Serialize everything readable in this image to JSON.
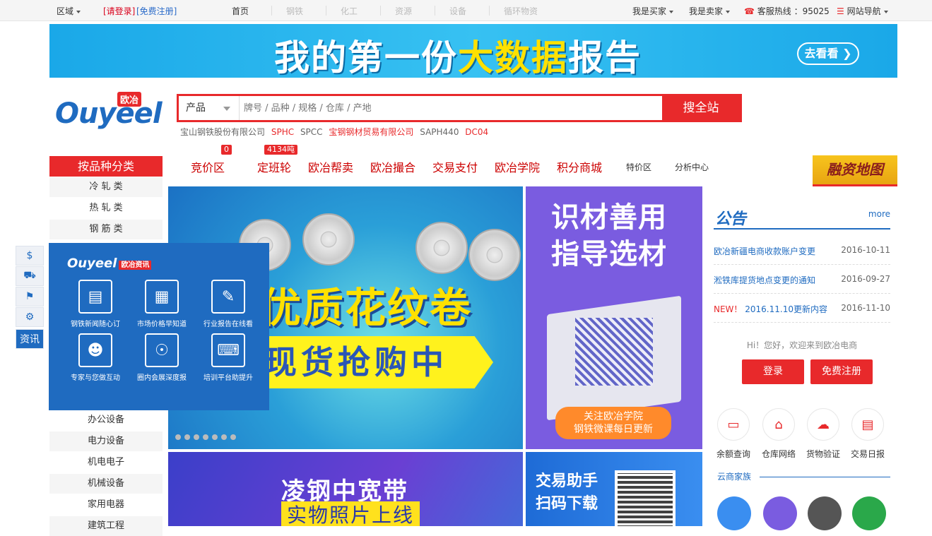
{
  "topbar": {
    "region": "区域",
    "login": "[请登录]",
    "register": "[免费注册]",
    "nav": [
      "首页",
      "钢铁",
      "化工",
      "资源",
      "设备",
      "循环物资"
    ],
    "buyer": "我是买家",
    "seller": "我是卖家",
    "hotline": "客服热线 ：95025",
    "sitenav": "网站导航"
  },
  "banner": {
    "text_before": "我的第一份",
    "text_highlight": "大数据",
    "text_after": "报告",
    "button": "去看看"
  },
  "logo": {
    "word": "Ouyeel",
    "tag": "欧冶"
  },
  "search": {
    "category": "产品",
    "placeholder": "牌号 / 品种 / 规格 / 仓库 / 产地",
    "button": "搜全站",
    "hotwords": [
      "宝山钢铁股份有限公司",
      "SPHC",
      "SPCC",
      "宝钢钢材贸易有限公司",
      "SAPH440",
      "DC04"
    ]
  },
  "category": {
    "title": "按品种分类",
    "items": [
      "冷 轧 类",
      "热 轧 类",
      "钢 筋 类"
    ],
    "items_lower": [
      "办公设备",
      "电力设备",
      "机电电子",
      "机械设备",
      "家用电器",
      "建筑工程"
    ]
  },
  "mainnav": {
    "items": [
      "竞价区",
      "定班轮",
      "欧冶帮卖",
      "欧冶撮合",
      "交易支付",
      "欧冶学院",
      "积分商城"
    ],
    "small": [
      "特价区",
      "分析中心"
    ],
    "badge_bidding": "0",
    "badge_liner": "4134吨",
    "finance_map": "融资地图"
  },
  "hero": {
    "line1": "优质花纹卷",
    "line2": "现货抢购中"
  },
  "promo": {
    "line1": "识材善用",
    "line2": "指导选材",
    "cta1": "关注欧冶学院",
    "cta2": "钢铁微课每日更新"
  },
  "banner2": {
    "line1": "凌钢中宽带",
    "line2": "实物照片上线"
  },
  "banner3": {
    "line1": "交易助手",
    "line2": "扫码下载"
  },
  "notice": {
    "title": "公告",
    "more": "more",
    "items": [
      {
        "prefix": "",
        "text": "欧冶新疆电商收款账户变更",
        "date": "2016-10-11"
      },
      {
        "prefix": "",
        "text": "淞铁库提货地点变更的通知",
        "date": "2016-09-27"
      },
      {
        "prefix": "NEW！",
        "text": "2016.11.10更新内容",
        "date": "2016-11-10"
      }
    ]
  },
  "welcome": "Hi！您好，欢迎来到欧冶电商",
  "auth": {
    "login": "登录",
    "register": "免费注册"
  },
  "services": [
    "余额查询",
    "仓库网络",
    "货物验证",
    "交易日报"
  ],
  "cloud": "云商家族",
  "sidebar": {
    "active_label": "资讯"
  },
  "popup": {
    "logo": "Ouyeel",
    "logo_tag": "欧冶资讯",
    "items": [
      "钢铁新闻随心订",
      "市场价格早知道",
      "行业报告在线看",
      "专家与您做互动",
      "圈内会展深度报",
      "培训平台助提升"
    ]
  },
  "colors": {
    "brand_red": "#e8292b",
    "brand_blue": "#1f6bc0"
  }
}
